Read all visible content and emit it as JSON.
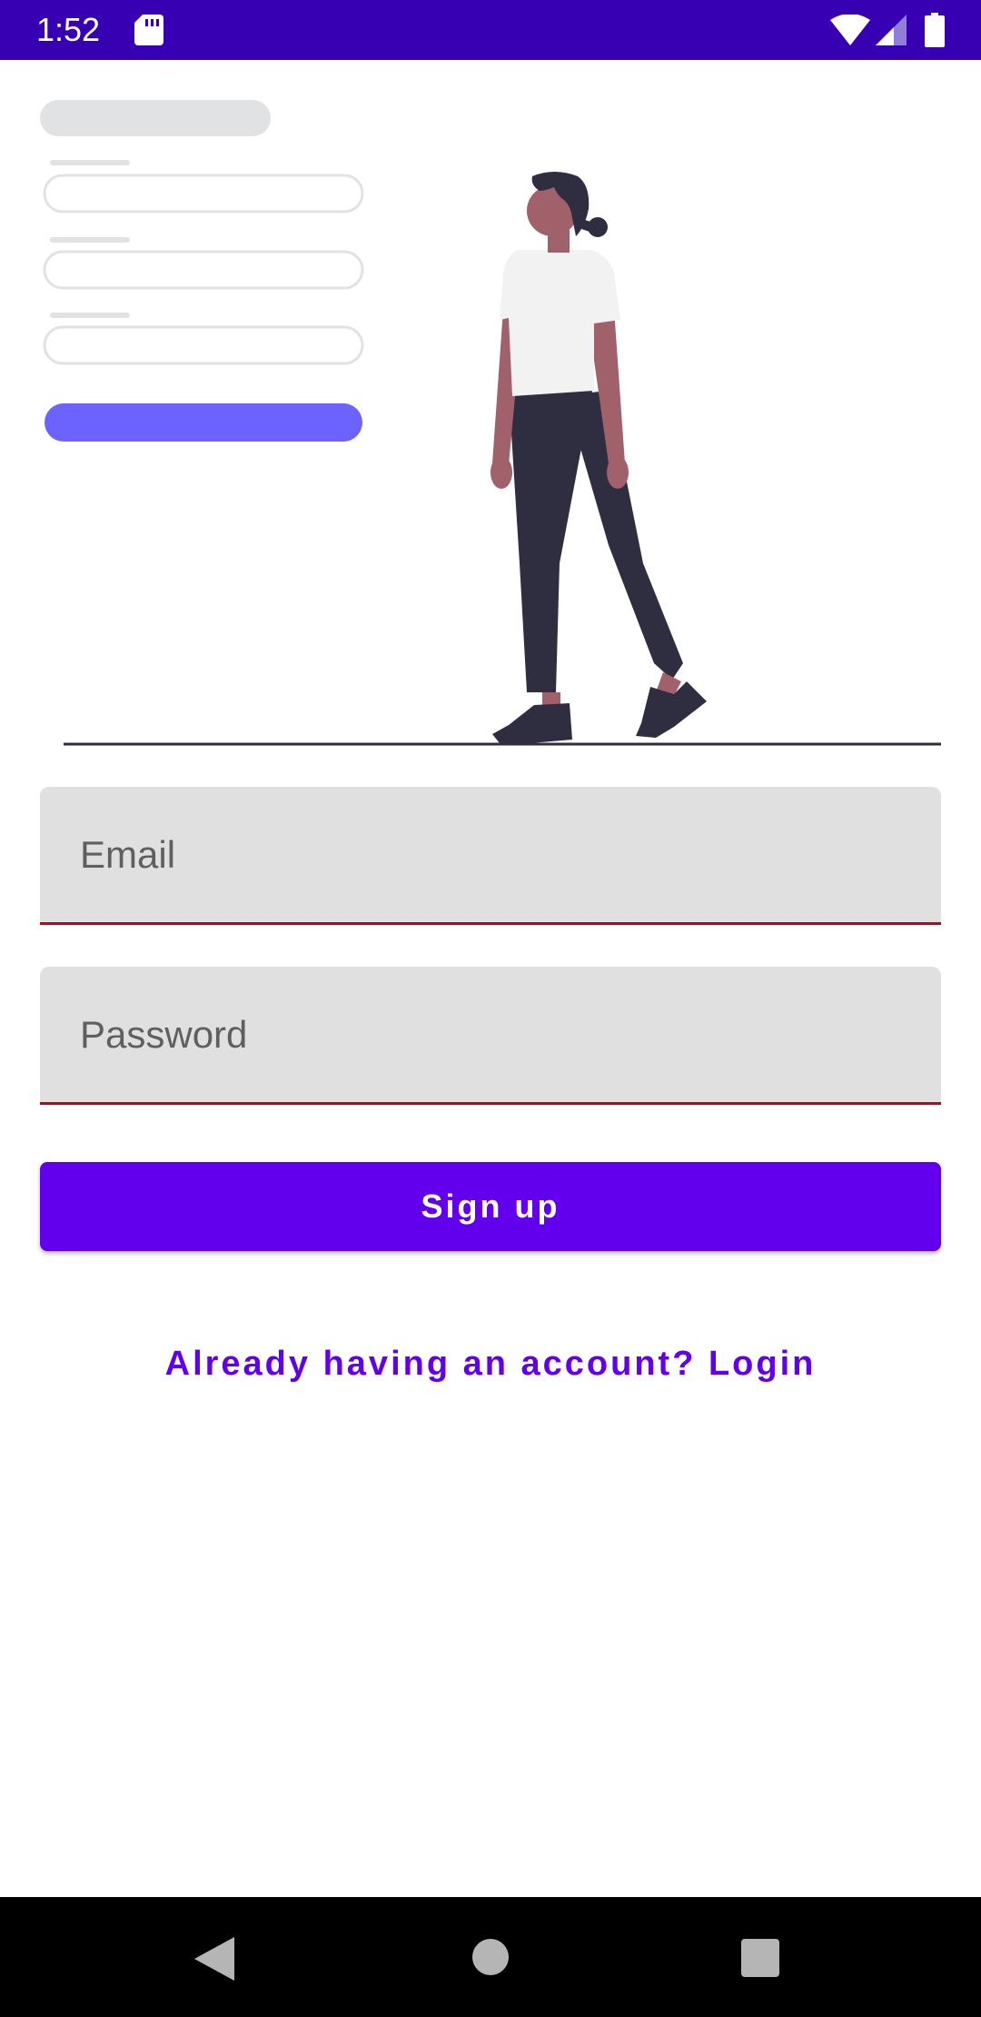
{
  "status_bar": {
    "time": "1:52",
    "background": "#3700b3",
    "icons": [
      "sd-card-icon",
      "wifi-icon",
      "cellular-signal-icon",
      "battery-icon"
    ]
  },
  "illustration": {
    "description_icon": "person-standing-next-to-signup-form-illustration",
    "colors": {
      "form_placeholder": "#e1e2e4",
      "form_button": "#6c63ff",
      "skin": "#a0616a",
      "hair_pants": "#2f2e41",
      "shirt": "#f2f2f2"
    }
  },
  "form": {
    "email_placeholder": "Email",
    "password_placeholder": "Password",
    "field_background": "#e0e0e0",
    "field_underline": "#c2001b"
  },
  "actions": {
    "signup_label": "Sign up",
    "login_link": "Already having an account? Login",
    "primary_color": "#6200ee"
  },
  "nav_bar": {
    "icons": [
      "back-icon",
      "home-icon",
      "recents-icon"
    ]
  }
}
